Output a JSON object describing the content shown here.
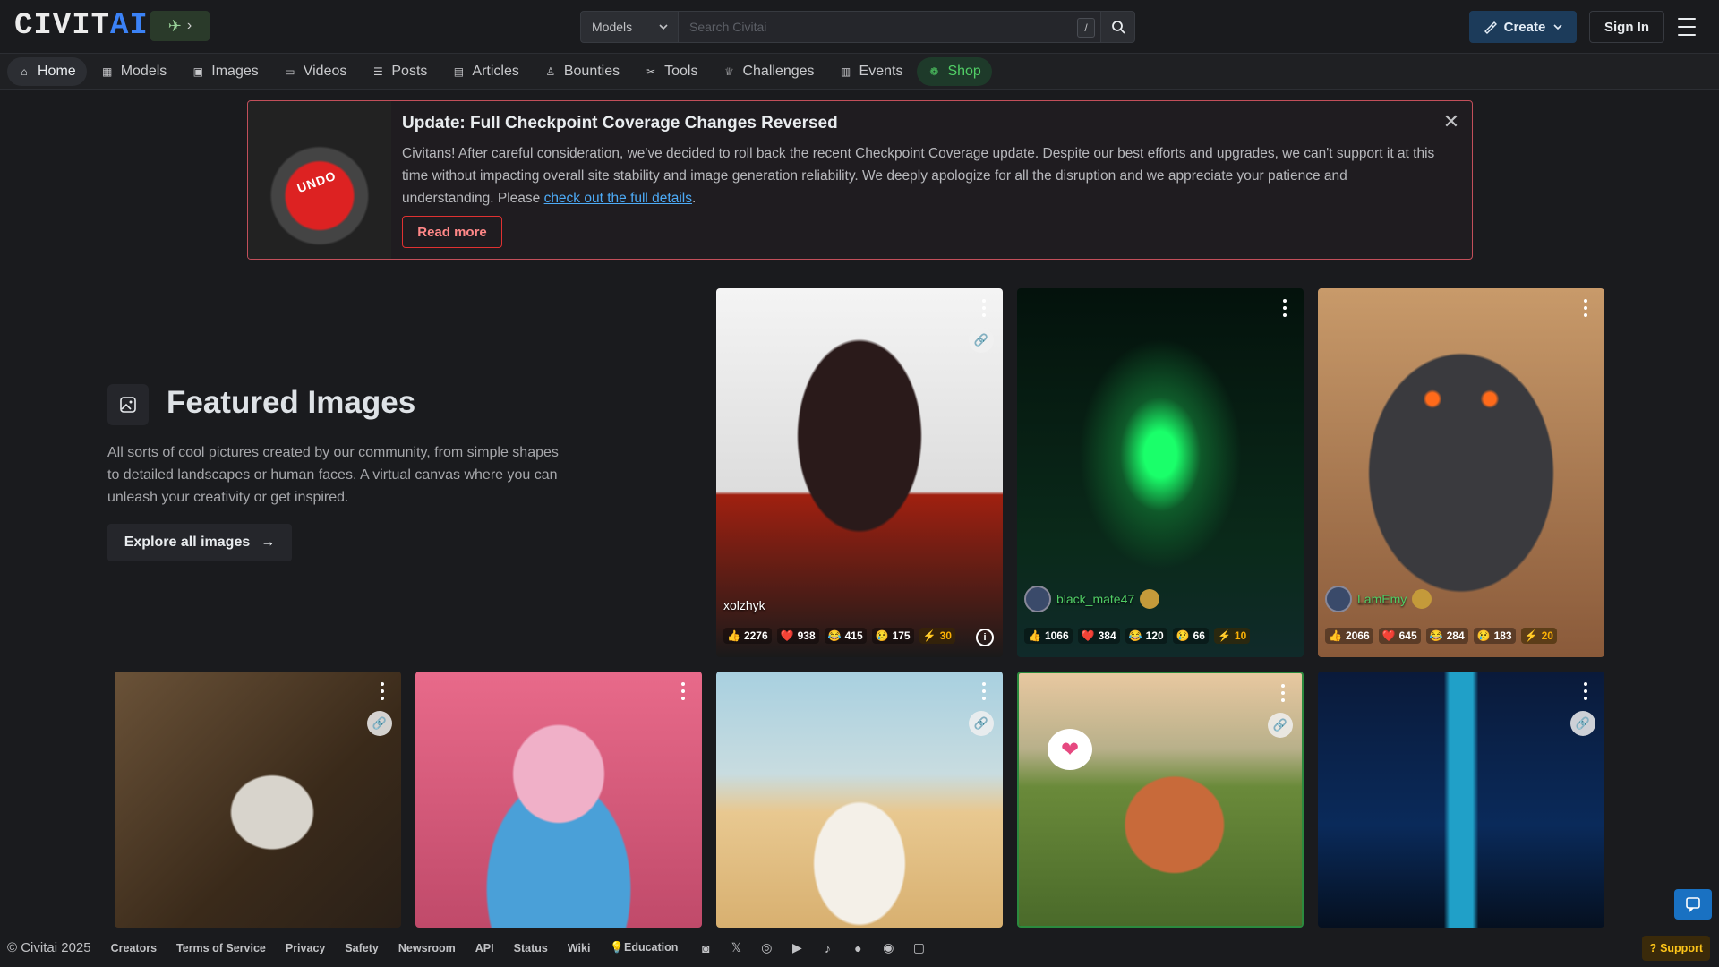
{
  "header": {
    "logo_main": "CIVIT",
    "logo_accent": "AI",
    "logo_badge_chevron": "›",
    "search_scope": "Models",
    "search_placeholder": "Search Civitai",
    "search_shortcut": "/",
    "create_label": "Create",
    "signin_label": "Sign In"
  },
  "nav": {
    "items": [
      {
        "label": "Home",
        "icon": "home-icon"
      },
      {
        "label": "Models",
        "icon": "grid-icon"
      },
      {
        "label": "Images",
        "icon": "image-icon"
      },
      {
        "label": "Videos",
        "icon": "video-icon"
      },
      {
        "label": "Posts",
        "icon": "posts-icon"
      },
      {
        "label": "Articles",
        "icon": "article-icon"
      },
      {
        "label": "Bounties",
        "icon": "bounty-icon"
      },
      {
        "label": "Tools",
        "icon": "tools-icon"
      },
      {
        "label": "Challenges",
        "icon": "trophy-icon"
      },
      {
        "label": "Events",
        "icon": "calendar-icon"
      },
      {
        "label": "Shop",
        "icon": "shop-icon"
      }
    ],
    "active": "Home"
  },
  "announcement": {
    "image_label": "UNDO",
    "title": "Update: Full Checkpoint Coverage Changes Reversed",
    "body_1": "Civitans! After careful consideration, we've decided to roll back the recent Checkpoint Coverage update. Despite our best efforts and upgrades, we can't support it at this time without impacting overall site stability and image generation reliability. We deeply apologize for all the disruption and we appreciate your patience and understanding. Please ",
    "body_link": "check out the full details",
    "body_2": ".",
    "button": "Read more",
    "close_icon": "✕"
  },
  "featured": {
    "title": "Featured Images",
    "description": "All sorts of cool pictures created by our community, from simple shapes to detailed landscapes or human faces. A virtual canvas where you can unleash your creativity or get inspired.",
    "button": "Explore all images",
    "button_arrow": "→"
  },
  "cards": [
    {
      "user": "xolzhyk",
      "likes": "2276",
      "hearts": "938",
      "laughs": "415",
      "cry": "175",
      "buzz": "30",
      "colors": [
        "#f4f4f4",
        "#a02010",
        "#1a1a1a"
      ]
    },
    {
      "user": "black_mate47",
      "likes": "1066",
      "hearts": "384",
      "laughs": "120",
      "cry": "66",
      "buzz": "10",
      "colors": [
        "#04120c",
        "#0f5a2a",
        "#1aff6a"
      ]
    },
    {
      "user": "LamEmy",
      "likes": "2066",
      "hearts": "645",
      "laughs": "284",
      "cry": "183",
      "buzz": "20",
      "colors": [
        "#c89a6a",
        "#3a3a3e",
        "#ff6a1a"
      ]
    },
    {
      "user": "",
      "colors": [
        "#6a5238",
        "#d8d4cc",
        "#2a2018"
      ]
    },
    {
      "user": "",
      "colors": [
        "#e86a8a",
        "#f0b0c8",
        "#4aa0d8"
      ]
    },
    {
      "user": "",
      "colors": [
        "#a8d0e0",
        "#e8c890",
        "#f4f0e8"
      ]
    },
    {
      "user": "",
      "colors": [
        "#e8c8a0",
        "#6a8a3a",
        "#c86a3a"
      ]
    },
    {
      "user": "",
      "colors": [
        "#0a1a3a",
        "#20a0c8",
        "#e04a8a"
      ]
    }
  ],
  "footer": {
    "copyright": "© Civitai 2025",
    "links": [
      "Creators",
      "Terms of Service",
      "Privacy",
      "Safety",
      "Newsroom",
      "API",
      "Status",
      "Wiki",
      "💡Education"
    ],
    "social_icons": [
      "discord-icon",
      "x-icon",
      "instagram-icon",
      "youtube-icon",
      "tiktok-icon",
      "reddit-icon",
      "github-icon",
      "chat-icon"
    ],
    "support": "Support"
  }
}
